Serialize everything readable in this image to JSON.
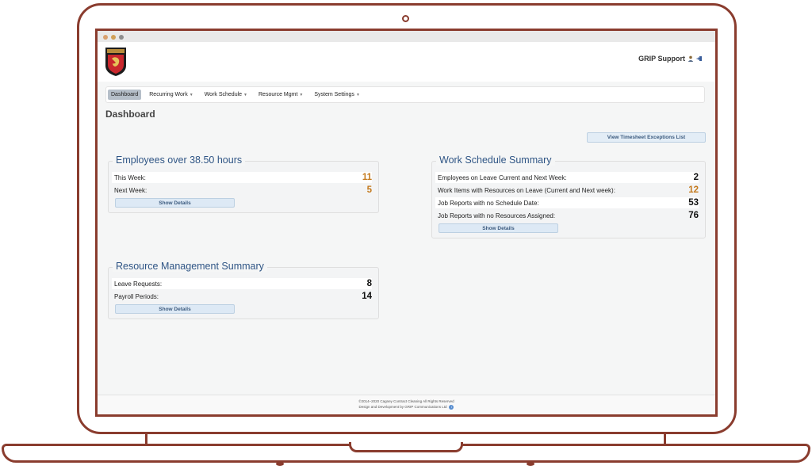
{
  "header": {
    "user_label": "GRIP Support",
    "user_icon": "person-icon",
    "logout_icon": "logout-icon"
  },
  "nav": {
    "items": [
      {
        "label": "Dashboard",
        "active": true
      },
      {
        "label": "Recurring Work",
        "dropdown": true
      },
      {
        "label": "Work Schedule",
        "dropdown": true
      },
      {
        "label": "Resource Mgmt",
        "dropdown": true
      },
      {
        "label": "System Settings",
        "dropdown": true
      }
    ]
  },
  "page": {
    "title": "Dashboard",
    "timesheet_button": "View Timesheet Exceptions List"
  },
  "employees_card": {
    "title": "Employees over 38.50 hours",
    "rows": [
      {
        "label": "This Week:",
        "value": "11"
      },
      {
        "label": "Next Week:",
        "value": "5"
      }
    ],
    "details_label": "Show Details"
  },
  "schedule_card": {
    "title": "Work Schedule Summary",
    "rows": [
      {
        "label": "Employees on Leave Current and Next Week:",
        "value": "2"
      },
      {
        "label": "Work Items with Resources on Leave (Current and Next week):",
        "value": "12"
      },
      {
        "label": "Job Reports with no Schedule Date:",
        "value": "53"
      },
      {
        "label": "Job Reports with no Resources Assigned:",
        "value": "76"
      }
    ],
    "details_label": "Show Details"
  },
  "resource_card": {
    "title": "Resource Management Summary",
    "rows": [
      {
        "label": "Leave Requests:",
        "value": "8"
      },
      {
        "label": "Payroll Periods:",
        "value": "14"
      }
    ],
    "details_label": "Show Details"
  },
  "footer": {
    "copyright": "©2014–2020 Cagney Contract Cleaning All Rights Reserved",
    "credit": "Design and Development by GRIP Communications Ltd"
  },
  "colors": {
    "accent_title": "#2f5585",
    "highlight_value": "#c47a1e",
    "frame": "#8a3c2e"
  }
}
